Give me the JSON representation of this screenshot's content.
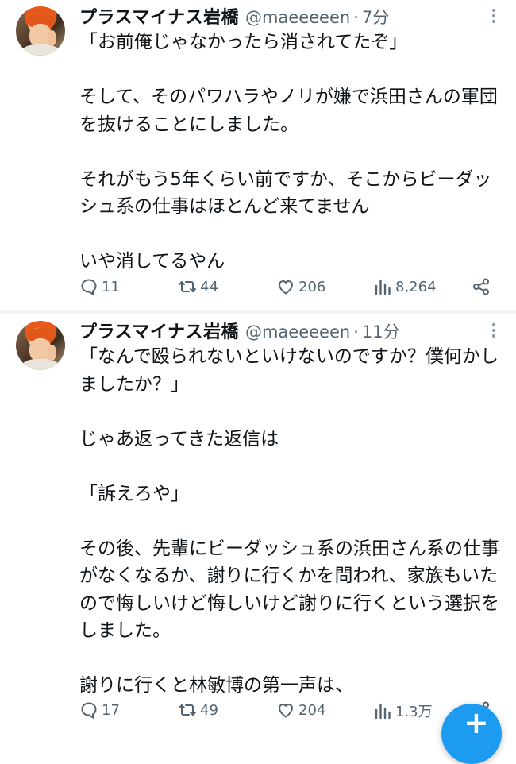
{
  "tweets": [
    {
      "display_name": "プラスマイナス岩橋",
      "handle": "@maeeeeen",
      "dot": "·",
      "time": "7分",
      "text": "「お前俺じゃなかったら消されてたぞ」\n\nそして、そのパワハラやノリが嫌で浜田さんの軍団を抜けることにしました。\n\nそれがもう5年くらい前ですか、そこからビーダッシュ系の仕事はほとんど来てません\n\nいや消してるやん",
      "replies": "11",
      "retweets": "44",
      "likes": "206",
      "views": "8,264"
    },
    {
      "display_name": "プラスマイナス岩橋",
      "handle": "@maeeeeen",
      "dot": "·",
      "time": "11分",
      "text": "「なんで殴られないといけないのですか？僕何かしましたか？」\n\nじゃあ返ってきた返信は\n\n「訴えろや」\n\nその後、先輩にビーダッシュ系の浜田さん系の仕事がなくなるか、謝りに行くかを問われ、家族もいたので悔しいけど悔しいけど謝りに行くという選択をしました。\n\n謝りに行くと林敏博の第一声は、",
      "replies": "17",
      "retweets": "49",
      "likes": "204",
      "views": "1.3万"
    }
  ],
  "icons": {
    "reply": "reply-icon",
    "retweet": "retweet-icon",
    "like": "heart-icon",
    "views": "views-icon",
    "share": "share-icon",
    "more": "more-icon",
    "compose": "compose-icon"
  },
  "fab_label": "+",
  "colors": {
    "accent": "#1d9bf0",
    "text": "#0f1419",
    "secondary": "#536471"
  }
}
